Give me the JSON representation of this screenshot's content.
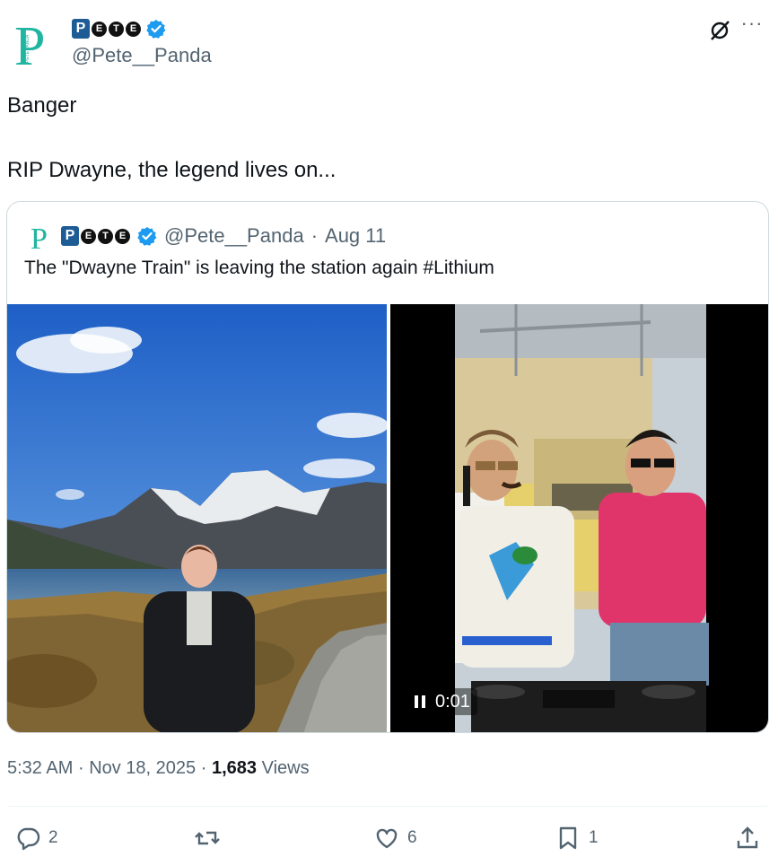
{
  "author": {
    "logo_letters": [
      "P",
      "E",
      "T",
      "E"
    ],
    "handle": "@Pete__Panda"
  },
  "tweet": {
    "lines": [
      "Banger",
      "RIP Dwayne, the legend lives on..."
    ]
  },
  "quoted": {
    "handle": "@Pete__Panda",
    "separator": "·",
    "date": "Aug 11",
    "text": "The \"Dwayne Train\" is leaving the station again #Lithium",
    "video_time": "0:01"
  },
  "meta": {
    "time": "5:32 AM",
    "separator": "·",
    "date": "Nov 18, 2025",
    "views_count": "1,683",
    "views_label": "Views"
  },
  "actions": {
    "replies": "2",
    "likes": "6",
    "bookmarks": "1"
  },
  "icons": {
    "verified": "verified-badge-icon",
    "grok": "grok-icon",
    "more": "more-icon"
  },
  "colors": {
    "verified_blue": "#1d9bf0",
    "brand_teal": "#1fb5a0",
    "text_secondary": "#536471",
    "border": "#cfd9de"
  }
}
